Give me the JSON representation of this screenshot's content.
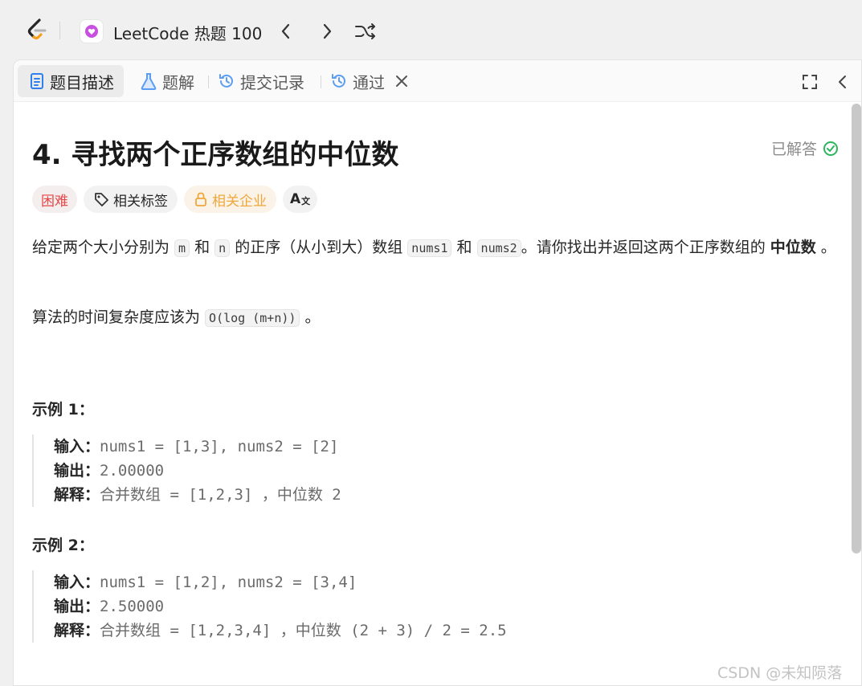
{
  "topbar": {
    "list_title": "LeetCode 热题 100"
  },
  "tabs": [
    {
      "label": "题目描述",
      "icon": "description-icon",
      "active": true
    },
    {
      "label": "题解",
      "icon": "flask-icon",
      "active": false
    },
    {
      "label": "提交记录",
      "icon": "history-icon",
      "active": false
    },
    {
      "label": "通过",
      "icon": "history-icon",
      "active": false
    }
  ],
  "problem": {
    "title": "4. 寻找两个正序数组的中位数",
    "status": "已解答",
    "tags": {
      "difficulty": "困难",
      "topics": "相关标签",
      "companies": "相关企业",
      "translate": "A"
    },
    "desc": {
      "p1_a": "给定两个大小分别为 ",
      "m": "m",
      "p1_b": " 和 ",
      "n": "n",
      "p1_c": " 的正序（从小到大）数组 ",
      "nums1": "nums1",
      "p1_d": " 和 ",
      "nums2": "nums2",
      "p1_e": "。请你找出并返回这两个正序数组的 ",
      "p1_bold": "中位数",
      "p1_f": " 。",
      "p2_a": "算法的时间复杂度应该为 ",
      "p2_code": "O(log (m+n))",
      "p2_b": " 。"
    },
    "examples": [
      {
        "title": "示例 1：",
        "input_label": "输入：",
        "input": "nums1 = [1,3], nums2 = [2]",
        "output_label": "输出：",
        "output": "2.00000",
        "explain_label": "解释：",
        "explain": "合并数组 = [1,2,3] ，中位数 2"
      },
      {
        "title": "示例 2：",
        "input_label": "输入：",
        "input": "nums1 = [1,2], nums2 = [3,4]",
        "output_label": "输出：",
        "output": "2.50000",
        "explain_label": "解释：",
        "explain": "合并数组 = [1,2,3,4] ，中位数 (2 + 3) / 2 = 2.5"
      }
    ]
  },
  "watermark": "CSDN @未知陨落",
  "colors": {
    "hard": "#e54848",
    "companies": "#f0a63a",
    "solved_check": "#2db55d",
    "list_icon": "#c84fdf"
  }
}
